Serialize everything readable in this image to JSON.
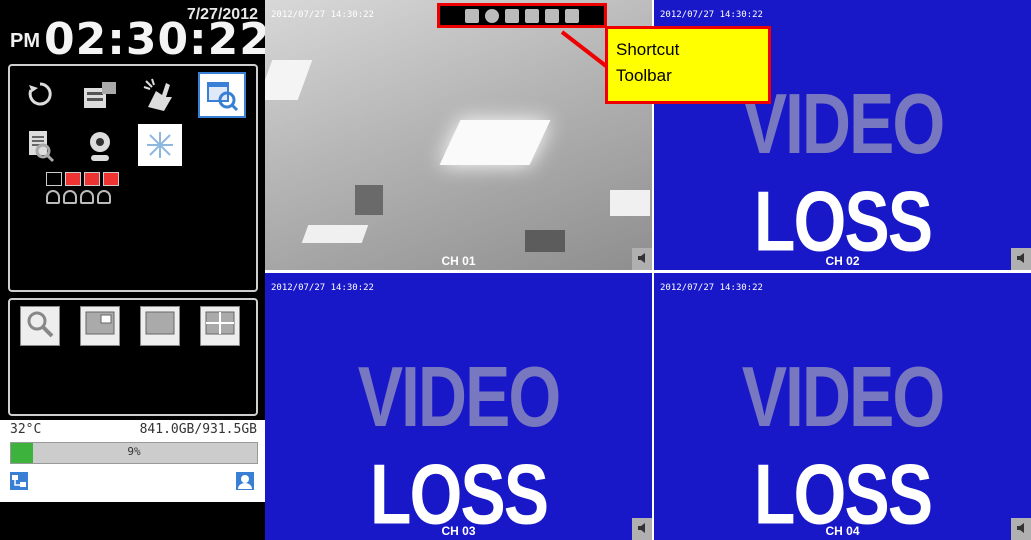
{
  "clock": {
    "date": "7/27/2012",
    "ampm": "PM",
    "time": "02:30:22"
  },
  "status": {
    "temperature": "32°C",
    "disk": "841.0GB/931.5GB",
    "percent_label": "9%",
    "percent": 0.09
  },
  "colors": {
    "video_loss_bg": "#1818c8",
    "toolbar_border": "#e00000",
    "callout_bg": "#ffff00",
    "progress_fill": "#3db33d"
  },
  "menu_icons": [
    "back-icon",
    "backup-icon",
    "ptz-icon",
    "schedule-search-icon",
    "log-search-icon",
    "webcam-icon",
    "freeze-icon"
  ],
  "view_buttons": [
    "zoom-icon",
    "pip-icon",
    "single-view-icon",
    "quad-view-icon"
  ],
  "toolbar_icons": [
    "lock-icon",
    "info-icon",
    "monitor-icon",
    "record-icon",
    "channel-icon",
    "list-icon"
  ],
  "callout": {
    "line1": "Shortcut",
    "line2": "Toolbar"
  },
  "channels": [
    {
      "label": "CH 01",
      "timestamp": "2012/07/27 14:30:22",
      "video_loss": false
    },
    {
      "label": "CH 02",
      "timestamp": "2012/07/27 14:30:22",
      "video_loss": true,
      "text1": "VIDEO",
      "text2": "LOSS"
    },
    {
      "label": "CH 03",
      "timestamp": "2012/07/27 14:30:22",
      "video_loss": true,
      "text1": "VIDEO",
      "text2": "LOSS"
    },
    {
      "label": "CH 04",
      "timestamp": "2012/07/27 14:30:22",
      "video_loss": true,
      "text1": "VIDEO",
      "text2": "LOSS"
    }
  ]
}
